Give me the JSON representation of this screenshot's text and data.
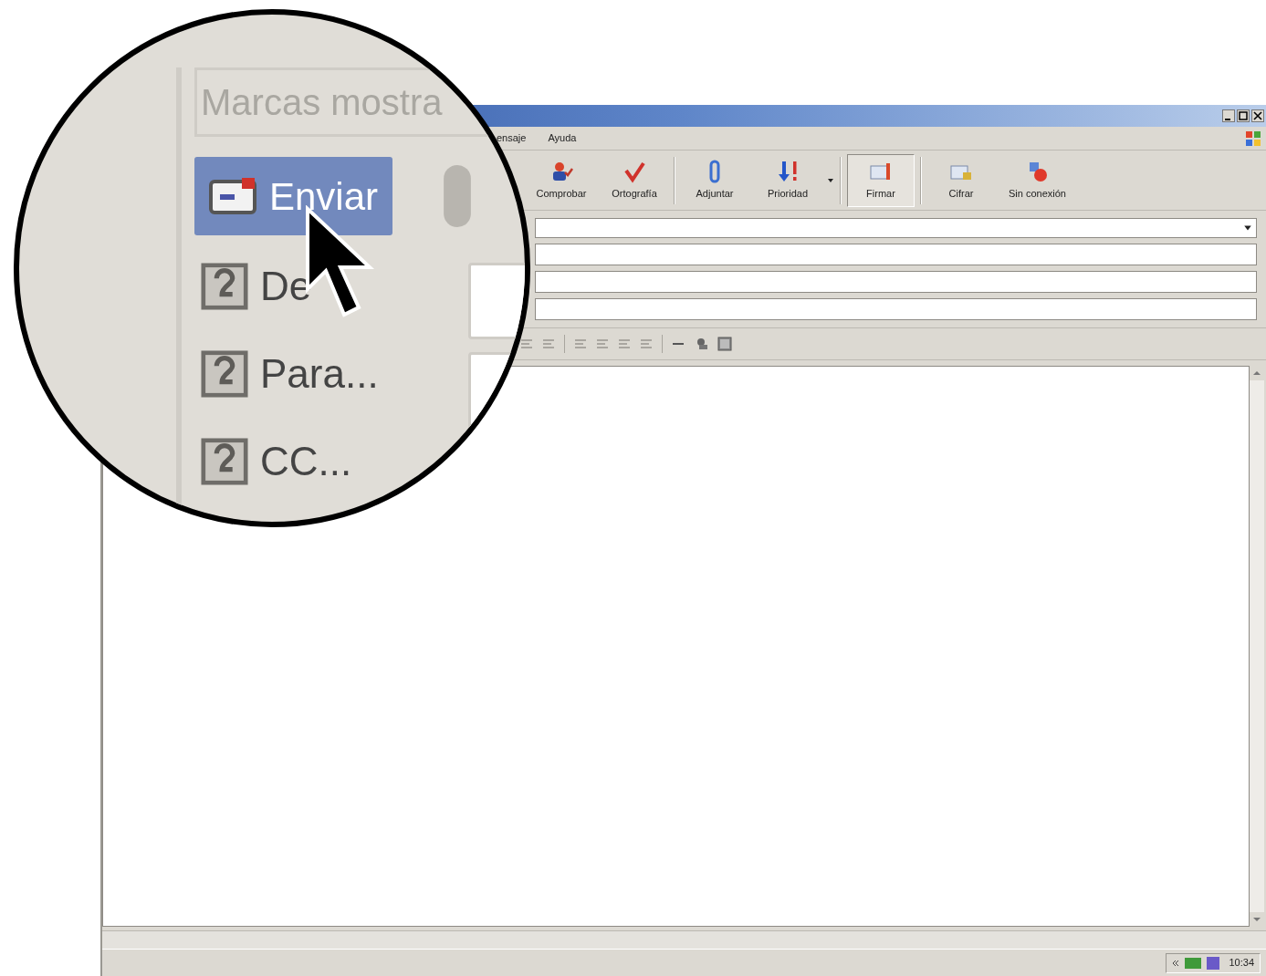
{
  "magnifier": {
    "field_text": "Marcas mostra",
    "buttons": [
      {
        "label": "Enviar",
        "kind": "send",
        "highlighted": true
      },
      {
        "label": "De",
        "kind": "address",
        "highlighted": false
      },
      {
        "label": "Para...",
        "kind": "address",
        "highlighted": false
      },
      {
        "label": "CC...",
        "kind": "address",
        "highlighted": false
      }
    ]
  },
  "menu": [
    "ensaje",
    "Ayuda"
  ],
  "toolbar": [
    {
      "label": "Comprobar",
      "kind": "check",
      "pressed": false,
      "separator_before": false
    },
    {
      "label": "Ortografía",
      "kind": "spelling",
      "pressed": false,
      "separator_before": false
    },
    {
      "label": "Adjuntar",
      "kind": "clip",
      "pressed": false,
      "separator_before": true
    },
    {
      "label": "Prioridad",
      "kind": "priority",
      "pressed": false,
      "separator_before": false,
      "dropdown": true
    },
    {
      "label": "Firmar",
      "kind": "sign",
      "pressed": true,
      "separator_before": true
    },
    {
      "label": "Cifrar",
      "kind": "encrypt",
      "pressed": false,
      "separator_before": true
    },
    {
      "label": "Sin conexión",
      "kind": "offline",
      "pressed": false,
      "separator_before": false
    }
  ],
  "status_bar": {
    "clock": "10:34"
  }
}
